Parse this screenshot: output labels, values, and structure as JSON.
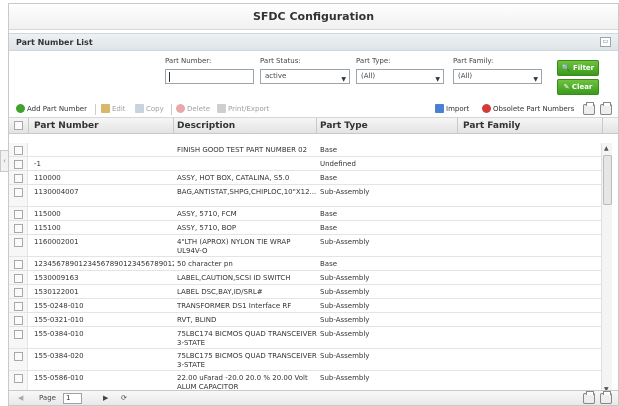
{
  "window": {
    "title": "SFDC Configuration"
  },
  "section": {
    "title": "Part Number List"
  },
  "filters": {
    "part_number_label": "Part Number:",
    "part_number_value": "",
    "part_status_label": "Part Status:",
    "part_status_value": "active",
    "part_type_label": "Part Type:",
    "part_type_value": "(All)",
    "part_family_label": "Part Family:",
    "part_family_value": "(All)",
    "filter_button": "Filter",
    "clear_button": "Clear"
  },
  "toolbar": {
    "add": "Add Part Number",
    "edit": "Edit",
    "copy": "Copy",
    "delete": "Delete",
    "print_export": "Print/Export",
    "import": "Import",
    "obsolete": "Obsolete Part Numbers"
  },
  "grid": {
    "columns": [
      "Part Number",
      "Description",
      "Part Type",
      "Part Family"
    ],
    "rows": [
      {
        "part_number": "",
        "description": "FINISH GOOD TEST PART NUMBER 02",
        "part_type": "Base"
      },
      {
        "part_number": "-1",
        "description": "",
        "part_type": "Undefined"
      },
      {
        "part_number": "110000",
        "description": "ASSY, HOT BOX, CATALINA, S5.0",
        "part_type": "Base"
      },
      {
        "part_number": "1130004007",
        "description": "BAG,ANTISTAT,SHPG,CHIPLOC,10\"X12...",
        "part_type": "Sub-Assembly"
      },
      {
        "part_number": "115000",
        "description": "ASSY, 5710, FCM",
        "part_type": "Base"
      },
      {
        "part_number": "115100",
        "description": "ASSY, 5710, BOP",
        "part_type": "Base"
      },
      {
        "part_number": "1160002001",
        "description": "4\"LTH (APROX) NYLON TIE WRAP UL94V-O",
        "part_type": "Sub-Assembly"
      },
      {
        "part_number": "12345678901234567890123456789012...",
        "description": "50 character pn",
        "part_type": "Base"
      },
      {
        "part_number": "1530009163",
        "description": "LABEL,CAUTION,SCSI ID SWITCH",
        "part_type": "Sub-Assembly"
      },
      {
        "part_number": "1530122001",
        "description": "LABEL DSC,BAY,ID/SRL#",
        "part_type": "Sub-Assembly"
      },
      {
        "part_number": "155-0248-010",
        "description": "TRANSFORMER DS1 Interface RF",
        "part_type": "Sub-Assembly"
      },
      {
        "part_number": "155-0321-010",
        "description": "RVT, BLIND",
        "part_type": "Sub-Assembly"
      },
      {
        "part_number": "155-0384-010",
        "description": "75LBC174 BICMOS QUAD TRANSCEIVER 3-STATE",
        "part_type": "Sub-Assembly"
      },
      {
        "part_number": "155-0384-020",
        "description": "75LBC175 BICMOS QUAD TRANSCEIVER 3-STATE",
        "part_type": "Sub-Assembly"
      },
      {
        "part_number": "155-0586-010",
        "description": "22.00 uFarad -20.0 20.0 % 20.00 Volt ALUM CAPACITOR",
        "part_type": "Sub-Assembly"
      }
    ]
  },
  "pager": {
    "page_label": "Page",
    "page_value": "1"
  },
  "colors": {
    "accent_green": "#4aa827",
    "header_gray": "#e3e3e3"
  }
}
